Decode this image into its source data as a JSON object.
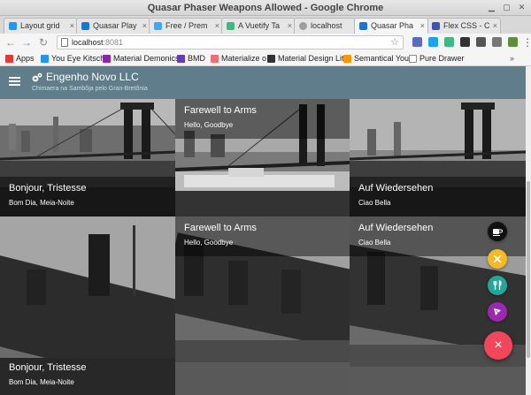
{
  "window": {
    "title": "Quasar Phaser Weapons Allowed - Google Chrome"
  },
  "tabs": [
    {
      "label": "Layout grid"
    },
    {
      "label": "Quasar Play"
    },
    {
      "label": "Free / Prem"
    },
    {
      "label": "A Vuetify Ta"
    },
    {
      "label": "localhost"
    },
    {
      "label": "Quasar Pha"
    },
    {
      "label": "Flex CSS - C"
    }
  ],
  "address": {
    "host": "localhost",
    "port": ":8081"
  },
  "bookmarks": [
    {
      "label": "Apps"
    },
    {
      "label": "You Eye Kitsch"
    },
    {
      "label": "Material Demonics"
    },
    {
      "label": "BMD"
    },
    {
      "label": "Materialize o"
    },
    {
      "label": "Material Design Lite"
    },
    {
      "label": "Semantical You"
    },
    {
      "label": "Pure Drawer"
    }
  ],
  "app": {
    "title": "Engenho Novo LLC",
    "subtitle": "Chimaera na Sambôja pelo Gran-Bretônia"
  },
  "cards": [
    {
      "title": "Bonjour, Tristesse",
      "subtitle": "Bom Dia, Meia-Noite"
    },
    {
      "title": "Farewell to Arms",
      "subtitle": "Hello, Goodbye"
    },
    {
      "title": "Auf Wiedersehen",
      "subtitle": "Ciao Bella"
    },
    {
      "title": "Farewell to Arms",
      "subtitle": "Hello, Goodbye"
    },
    {
      "title": "Auf Wiedersehen",
      "subtitle": "Ciao Bella"
    },
    {
      "title": "Bonjour, Tristesse",
      "subtitle": "Bom Dia, Meia-Noite"
    }
  ],
  "fab": {
    "main_icon": "×",
    "actions": [
      {
        "icon": "coffee-icon",
        "color": "#111111"
      },
      {
        "icon": "utensils-crossed-icon",
        "color": "#f5b924"
      },
      {
        "icon": "restaurant-icon",
        "color": "#26a69a"
      },
      {
        "icon": "pizza-icon",
        "color": "#9c27b0"
      }
    ],
    "main_color": "#f4465a"
  },
  "colors": {
    "appbar": "#607d8b"
  }
}
